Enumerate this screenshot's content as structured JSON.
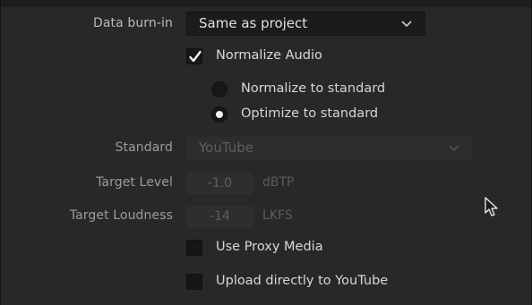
{
  "data_burn_in": {
    "label": "Data burn-in",
    "value": "Same as project",
    "icon": "chevron-down-icon"
  },
  "normalize_audio": {
    "label": "Normalize Audio",
    "checked": true,
    "options": [
      {
        "label": "Normalize to standard",
        "selected": false
      },
      {
        "label": "Optimize to standard",
        "selected": true
      }
    ]
  },
  "standard": {
    "label": "Standard",
    "value": "YouTube",
    "disabled": true
  },
  "target_level": {
    "label": "Target Level",
    "value": "-1.0",
    "unit": "dBTP"
  },
  "target_loudness": {
    "label": "Target Loudness",
    "value": "-14",
    "unit": "LKFS"
  },
  "use_proxy_media": {
    "label": "Use Proxy Media",
    "checked": false
  },
  "upload_youtube": {
    "label": "Upload directly to YouTube",
    "checked": false
  },
  "colors": {
    "panel": "#28282a",
    "control": "#1b1b1c",
    "disabled_text": "#5e5e5e"
  }
}
